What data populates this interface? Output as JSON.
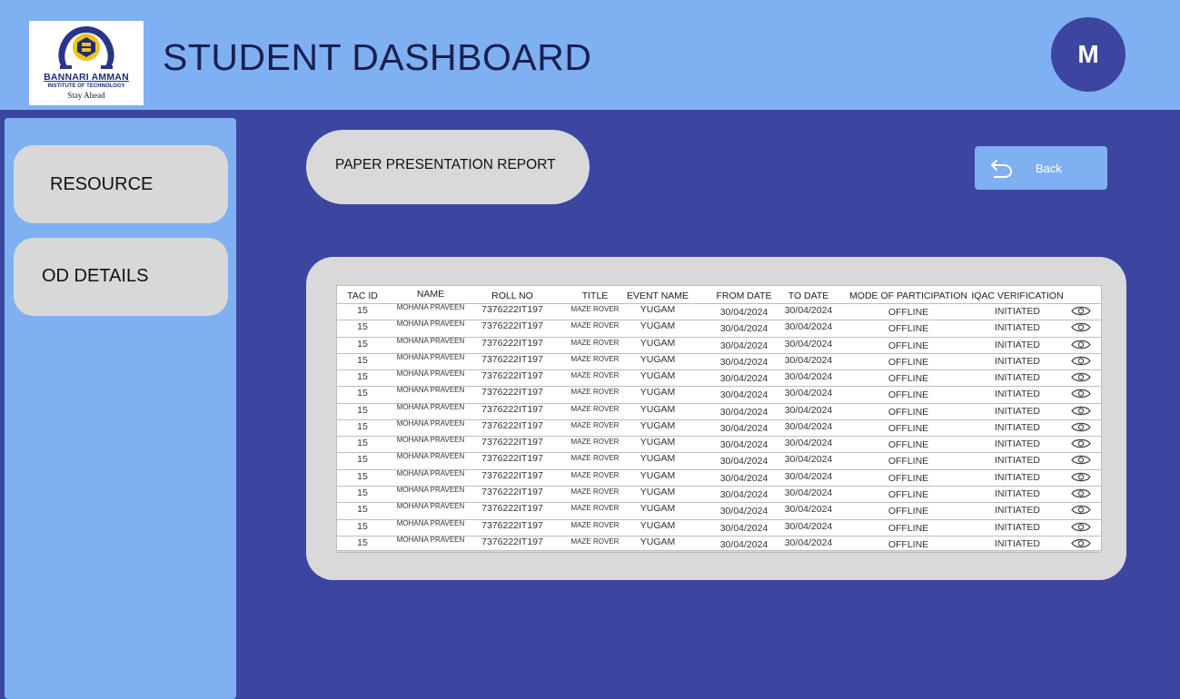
{
  "header": {
    "logo": {
      "name": "BANNARI AMMAN",
      "sub": "INSTITUTE OF TECHNOLOGY",
      "tagline": "Stay Ahead"
    },
    "title": "STUDENT DASHBOARD",
    "avatar_initial": "M"
  },
  "sidebar": {
    "items": [
      {
        "label": "RESOURCE"
      },
      {
        "label": "OD DETAILS"
      }
    ]
  },
  "main": {
    "report_title": "PAPER PRESENTATION REPORT",
    "back_label": "Back",
    "table": {
      "columns": [
        "TAC ID",
        "NAME",
        "ROLL NO",
        "TITLE",
        "EVENT NAME",
        "FROM DATE",
        "TO DATE",
        "MODE OF PARTICIPATION",
        "IQAC VERIFICATION"
      ],
      "rows": [
        [
          "15",
          "MOHANA PRAVEEN",
          "7376222IT197",
          "MAZE ROVER",
          "YUGAM",
          "30/04/2024",
          "30/04/2024",
          "OFFLINE",
          "INITIATED"
        ],
        [
          "15",
          "MOHANA PRAVEEN",
          "7376222IT197",
          "MAZE ROVER",
          "YUGAM",
          "30/04/2024",
          "30/04/2024",
          "OFFLINE",
          "INITIATED"
        ],
        [
          "15",
          "MOHANA PRAVEEN",
          "7376222IT197",
          "MAZE ROVER",
          "YUGAM",
          "30/04/2024",
          "30/04/2024",
          "OFFLINE",
          "INITIATED"
        ],
        [
          "15",
          "MOHANA PRAVEEN",
          "7376222IT197",
          "MAZE ROVER",
          "YUGAM",
          "30/04/2024",
          "30/04/2024",
          "OFFLINE",
          "INITIATED"
        ],
        [
          "15",
          "MOHANA PRAVEEN",
          "7376222IT197",
          "MAZE ROVER",
          "YUGAM",
          "30/04/2024",
          "30/04/2024",
          "OFFLINE",
          "INITIATED"
        ],
        [
          "15",
          "MOHANA PRAVEEN",
          "7376222IT197",
          "MAZE ROVER",
          "YUGAM",
          "30/04/2024",
          "30/04/2024",
          "OFFLINE",
          "INITIATED"
        ],
        [
          "15",
          "MOHANA PRAVEEN",
          "7376222IT197",
          "MAZE ROVER",
          "YUGAM",
          "30/04/2024",
          "30/04/2024",
          "OFFLINE",
          "INITIATED"
        ],
        [
          "15",
          "MOHANA PRAVEEN",
          "7376222IT197",
          "MAZE ROVER",
          "YUGAM",
          "30/04/2024",
          "30/04/2024",
          "OFFLINE",
          "INITIATED"
        ],
        [
          "15",
          "MOHANA PRAVEEN",
          "7376222IT197",
          "MAZE ROVER",
          "YUGAM",
          "30/04/2024",
          "30/04/2024",
          "OFFLINE",
          "INITIATED"
        ],
        [
          "15",
          "MOHANA PRAVEEN",
          "7376222IT197",
          "MAZE ROVER",
          "YUGAM",
          "30/04/2024",
          "30/04/2024",
          "OFFLINE",
          "INITIATED"
        ],
        [
          "15",
          "MOHANA PRAVEEN",
          "7376222IT197",
          "MAZE ROVER",
          "YUGAM",
          "30/04/2024",
          "30/04/2024",
          "OFFLINE",
          "INITIATED"
        ],
        [
          "15",
          "MOHANA PRAVEEN",
          "7376222IT197",
          "MAZE ROVER",
          "YUGAM",
          "30/04/2024",
          "30/04/2024",
          "OFFLINE",
          "INITIATED"
        ],
        [
          "15",
          "MOHANA PRAVEEN",
          "7376222IT197",
          "MAZE ROVER",
          "YUGAM",
          "30/04/2024",
          "30/04/2024",
          "OFFLINE",
          "INITIATED"
        ],
        [
          "15",
          "MOHANA PRAVEEN",
          "7376222IT197",
          "MAZE ROVER",
          "YUGAM",
          "30/04/2024",
          "30/04/2024",
          "OFFLINE",
          "INITIATED"
        ],
        [
          "15",
          "MOHANA PRAVEEN",
          "7376222IT197",
          "MAZE ROVER",
          "YUGAM",
          "30/04/2024",
          "30/04/2024",
          "OFFLINE",
          "INITIATED"
        ]
      ],
      "row_action_icon": "eye-icon"
    }
  },
  "colors": {
    "background": "#3c45a0",
    "header": "#7fb0f1",
    "sidebar": "#7fb0f1",
    "card": "#d9d9d9",
    "back_button": "#7fb0f1"
  }
}
